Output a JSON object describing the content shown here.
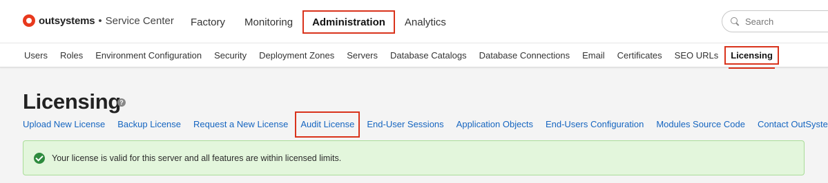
{
  "header": {
    "brand": "outsystems",
    "separator": "•",
    "product": "Service Center",
    "nav": [
      {
        "label": "Factory",
        "active": false
      },
      {
        "label": "Monitoring",
        "active": false
      },
      {
        "label": "Administration",
        "active": true
      },
      {
        "label": "Analytics",
        "active": false
      }
    ],
    "search": {
      "placeholder": "Search",
      "value": ""
    }
  },
  "subnav": [
    {
      "label": "Users",
      "active": false
    },
    {
      "label": "Roles",
      "active": false
    },
    {
      "label": "Environment Configuration",
      "active": false
    },
    {
      "label": "Security",
      "active": false
    },
    {
      "label": "Deployment Zones",
      "active": false
    },
    {
      "label": "Servers",
      "active": false
    },
    {
      "label": "Database Catalogs",
      "active": false
    },
    {
      "label": "Database Connections",
      "active": false
    },
    {
      "label": "Email",
      "active": false
    },
    {
      "label": "Certificates",
      "active": false
    },
    {
      "label": "SEO URLs",
      "active": false
    },
    {
      "label": "Licensing",
      "active": true
    }
  ],
  "page": {
    "title": "Licensing",
    "help_icon": "?",
    "actions": [
      {
        "label": "Upload New License",
        "active": false
      },
      {
        "label": "Backup License",
        "active": false
      },
      {
        "label": "Request a New License",
        "active": false
      },
      {
        "label": "Audit License",
        "active": true
      },
      {
        "label": "End-User Sessions",
        "active": false
      },
      {
        "label": "Application Objects",
        "active": false
      },
      {
        "label": "End-Users Configuration",
        "active": false
      },
      {
        "label": "Modules Source Code",
        "active": false
      },
      {
        "label": "Contact OutSystems",
        "active": false
      }
    ],
    "alert": {
      "icon": "check-circle-icon",
      "text": "Your license is valid for this server and all features are within licensed limits."
    }
  },
  "colors": {
    "accent": "#d9321b",
    "link": "#1565c0",
    "success_bg": "#e3f6dc",
    "success_border": "#a9dc98",
    "success_icon": "#2e8b3e"
  }
}
